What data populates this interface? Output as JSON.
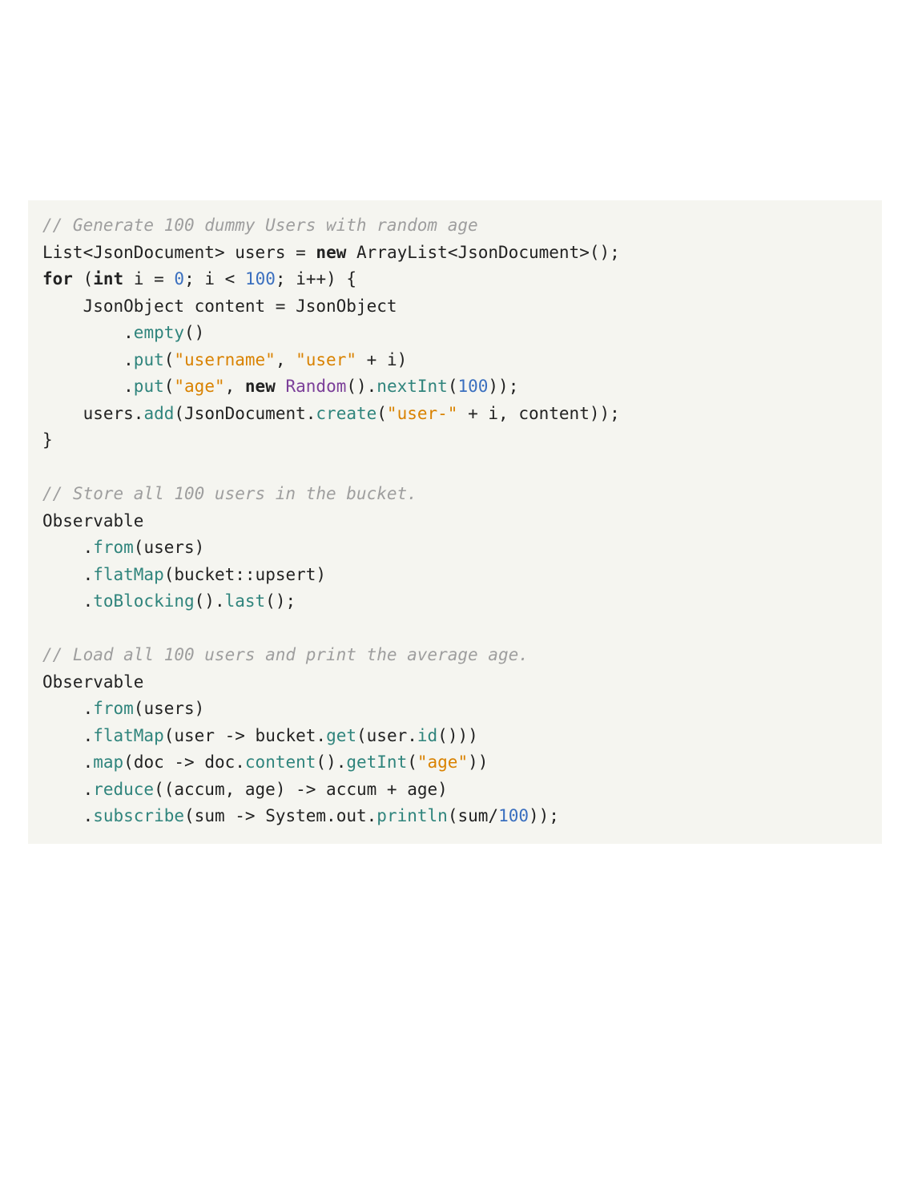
{
  "colors": {
    "background": "#f5f5f0",
    "comment": "#9e9e9e",
    "keyword": "#222222",
    "method": "#2f847c",
    "string": "#d98200",
    "number": "#3a6fbf",
    "class": "#7b3f99",
    "plain": "#222222"
  },
  "code": {
    "lines": [
      [
        {
          "t": "comment",
          "v": "// Generate 100 dummy Users with random age"
        }
      ],
      [
        {
          "t": "type",
          "v": "List"
        },
        {
          "t": "punct",
          "v": "<"
        },
        {
          "t": "type",
          "v": "JsonDocument"
        },
        {
          "t": "punct",
          "v": ">"
        },
        {
          "t": "plain",
          "v": " users "
        },
        {
          "t": "punct",
          "v": "= "
        },
        {
          "t": "keyword",
          "v": "new"
        },
        {
          "t": "plain",
          "v": " "
        },
        {
          "t": "type",
          "v": "ArrayList"
        },
        {
          "t": "punct",
          "v": "<"
        },
        {
          "t": "type",
          "v": "JsonDocument"
        },
        {
          "t": "punct",
          "v": ">();"
        }
      ],
      [
        {
          "t": "keyword",
          "v": "for"
        },
        {
          "t": "plain",
          "v": " ("
        },
        {
          "t": "keyword",
          "v": "int"
        },
        {
          "t": "plain",
          "v": " i "
        },
        {
          "t": "punct",
          "v": "= "
        },
        {
          "t": "number",
          "v": "0"
        },
        {
          "t": "punct",
          "v": "; "
        },
        {
          "t": "plain",
          "v": "i "
        },
        {
          "t": "punct",
          "v": "< "
        },
        {
          "t": "number",
          "v": "100"
        },
        {
          "t": "punct",
          "v": "; "
        },
        {
          "t": "plain",
          "v": "i"
        },
        {
          "t": "punct",
          "v": "++) {"
        }
      ],
      [
        {
          "t": "plain",
          "v": "    JsonObject content "
        },
        {
          "t": "punct",
          "v": "= "
        },
        {
          "t": "type",
          "v": "JsonObject"
        }
      ],
      [
        {
          "t": "plain",
          "v": "        ."
        },
        {
          "t": "method",
          "v": "empty"
        },
        {
          "t": "punct",
          "v": "()"
        }
      ],
      [
        {
          "t": "plain",
          "v": "        ."
        },
        {
          "t": "method",
          "v": "put"
        },
        {
          "t": "punct",
          "v": "("
        },
        {
          "t": "string",
          "v": "\"username\""
        },
        {
          "t": "punct",
          "v": ", "
        },
        {
          "t": "string",
          "v": "\"user\""
        },
        {
          "t": "plain",
          "v": " "
        },
        {
          "t": "punct",
          "v": "+ "
        },
        {
          "t": "plain",
          "v": "i"
        },
        {
          "t": "punct",
          "v": ")"
        }
      ],
      [
        {
          "t": "plain",
          "v": "        ."
        },
        {
          "t": "method",
          "v": "put"
        },
        {
          "t": "punct",
          "v": "("
        },
        {
          "t": "string",
          "v": "\"age\""
        },
        {
          "t": "punct",
          "v": ", "
        },
        {
          "t": "keyword",
          "v": "new"
        },
        {
          "t": "plain",
          "v": " "
        },
        {
          "t": "class",
          "v": "Random"
        },
        {
          "t": "punct",
          "v": "()."
        },
        {
          "t": "method",
          "v": "nextInt"
        },
        {
          "t": "punct",
          "v": "("
        },
        {
          "t": "number",
          "v": "100"
        },
        {
          "t": "punct",
          "v": "));"
        }
      ],
      [
        {
          "t": "plain",
          "v": "    users."
        },
        {
          "t": "method",
          "v": "add"
        },
        {
          "t": "punct",
          "v": "("
        },
        {
          "t": "type",
          "v": "JsonDocument"
        },
        {
          "t": "punct",
          "v": "."
        },
        {
          "t": "method",
          "v": "create"
        },
        {
          "t": "punct",
          "v": "("
        },
        {
          "t": "string",
          "v": "\"user-\""
        },
        {
          "t": "plain",
          "v": " "
        },
        {
          "t": "punct",
          "v": "+ "
        },
        {
          "t": "plain",
          "v": "i"
        },
        {
          "t": "punct",
          "v": ", "
        },
        {
          "t": "plain",
          "v": "content"
        },
        {
          "t": "punct",
          "v": "));"
        }
      ],
      [
        {
          "t": "punct",
          "v": "}"
        }
      ],
      [
        {
          "t": "plain",
          "v": ""
        }
      ],
      [
        {
          "t": "comment",
          "v": "// Store all 100 users in the bucket."
        }
      ],
      [
        {
          "t": "type",
          "v": "Observable"
        }
      ],
      [
        {
          "t": "plain",
          "v": "    ."
        },
        {
          "t": "method",
          "v": "from"
        },
        {
          "t": "punct",
          "v": "("
        },
        {
          "t": "plain",
          "v": "users"
        },
        {
          "t": "punct",
          "v": ")"
        }
      ],
      [
        {
          "t": "plain",
          "v": "    ."
        },
        {
          "t": "method",
          "v": "flatMap"
        },
        {
          "t": "punct",
          "v": "("
        },
        {
          "t": "plain",
          "v": "bucket"
        },
        {
          "t": "punct",
          "v": "::"
        },
        {
          "t": "plain",
          "v": "upsert"
        },
        {
          "t": "punct",
          "v": ")"
        }
      ],
      [
        {
          "t": "plain",
          "v": "    ."
        },
        {
          "t": "method",
          "v": "toBlocking"
        },
        {
          "t": "punct",
          "v": "()."
        },
        {
          "t": "method",
          "v": "last"
        },
        {
          "t": "punct",
          "v": "();"
        }
      ],
      [
        {
          "t": "plain",
          "v": ""
        }
      ],
      [
        {
          "t": "comment",
          "v": "// Load all 100 users and print the average age."
        }
      ],
      [
        {
          "t": "type",
          "v": "Observable"
        }
      ],
      [
        {
          "t": "plain",
          "v": "    ."
        },
        {
          "t": "method",
          "v": "from"
        },
        {
          "t": "punct",
          "v": "("
        },
        {
          "t": "plain",
          "v": "users"
        },
        {
          "t": "punct",
          "v": ")"
        }
      ],
      [
        {
          "t": "plain",
          "v": "    ."
        },
        {
          "t": "method",
          "v": "flatMap"
        },
        {
          "t": "punct",
          "v": "("
        },
        {
          "t": "plain",
          "v": "user "
        },
        {
          "t": "punct",
          "v": "-> "
        },
        {
          "t": "plain",
          "v": "bucket."
        },
        {
          "t": "method",
          "v": "get"
        },
        {
          "t": "punct",
          "v": "("
        },
        {
          "t": "plain",
          "v": "user."
        },
        {
          "t": "method",
          "v": "id"
        },
        {
          "t": "punct",
          "v": "()))"
        }
      ],
      [
        {
          "t": "plain",
          "v": "    ."
        },
        {
          "t": "method",
          "v": "map"
        },
        {
          "t": "punct",
          "v": "("
        },
        {
          "t": "plain",
          "v": "doc "
        },
        {
          "t": "punct",
          "v": "-> "
        },
        {
          "t": "plain",
          "v": "doc."
        },
        {
          "t": "method",
          "v": "content"
        },
        {
          "t": "punct",
          "v": "()."
        },
        {
          "t": "method",
          "v": "getInt"
        },
        {
          "t": "punct",
          "v": "("
        },
        {
          "t": "string",
          "v": "\"age\""
        },
        {
          "t": "punct",
          "v": "))"
        }
      ],
      [
        {
          "t": "plain",
          "v": "    ."
        },
        {
          "t": "method",
          "v": "reduce"
        },
        {
          "t": "punct",
          "v": "(("
        },
        {
          "t": "plain",
          "v": "accum"
        },
        {
          "t": "punct",
          "v": ", "
        },
        {
          "t": "plain",
          "v": "age"
        },
        {
          "t": "punct",
          "v": ") -> "
        },
        {
          "t": "plain",
          "v": "accum "
        },
        {
          "t": "punct",
          "v": "+ "
        },
        {
          "t": "plain",
          "v": "age"
        },
        {
          "t": "punct",
          "v": ")"
        }
      ],
      [
        {
          "t": "plain",
          "v": "    ."
        },
        {
          "t": "method",
          "v": "subscribe"
        },
        {
          "t": "punct",
          "v": "("
        },
        {
          "t": "plain",
          "v": "sum "
        },
        {
          "t": "punct",
          "v": "-> "
        },
        {
          "t": "type",
          "v": "System"
        },
        {
          "t": "punct",
          "v": "."
        },
        {
          "t": "plain",
          "v": "out"
        },
        {
          "t": "punct",
          "v": "."
        },
        {
          "t": "method",
          "v": "println"
        },
        {
          "t": "punct",
          "v": "("
        },
        {
          "t": "plain",
          "v": "sum"
        },
        {
          "t": "punct",
          "v": "/"
        },
        {
          "t": "number",
          "v": "100"
        },
        {
          "t": "punct",
          "v": "));"
        }
      ]
    ]
  }
}
